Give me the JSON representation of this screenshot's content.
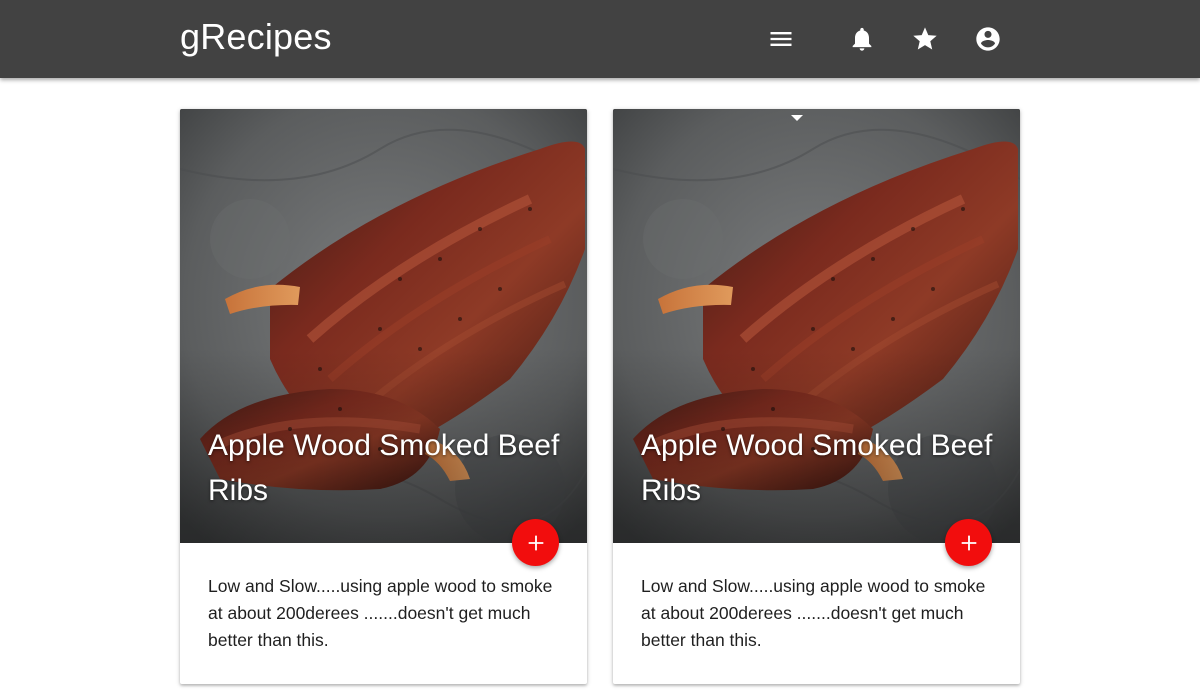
{
  "app": {
    "title": "gRecipes"
  },
  "header": {
    "icons": [
      "menu-icon",
      "notifications-icon",
      "star-icon",
      "account-icon"
    ]
  },
  "colors": {
    "header_bg": "#424242",
    "fab": "#f20d0d",
    "text": "#1f1f1f"
  },
  "cards": [
    {
      "title": "Apple Wood Smoked Beef Ribs",
      "description": "Low and Slow.....using apple wood to smoke at about 200derees .......doesn't get much better than this.",
      "image": "smoked-ribs-photo",
      "action_icon": "add-icon"
    },
    {
      "title": "Apple Wood Smoked Beef Ribs",
      "description": "Low and Slow.....using apple wood to smoke at about 200derees .......doesn't get much better than this.",
      "image": "smoked-ribs-photo",
      "action_icon": "add-icon"
    }
  ]
}
